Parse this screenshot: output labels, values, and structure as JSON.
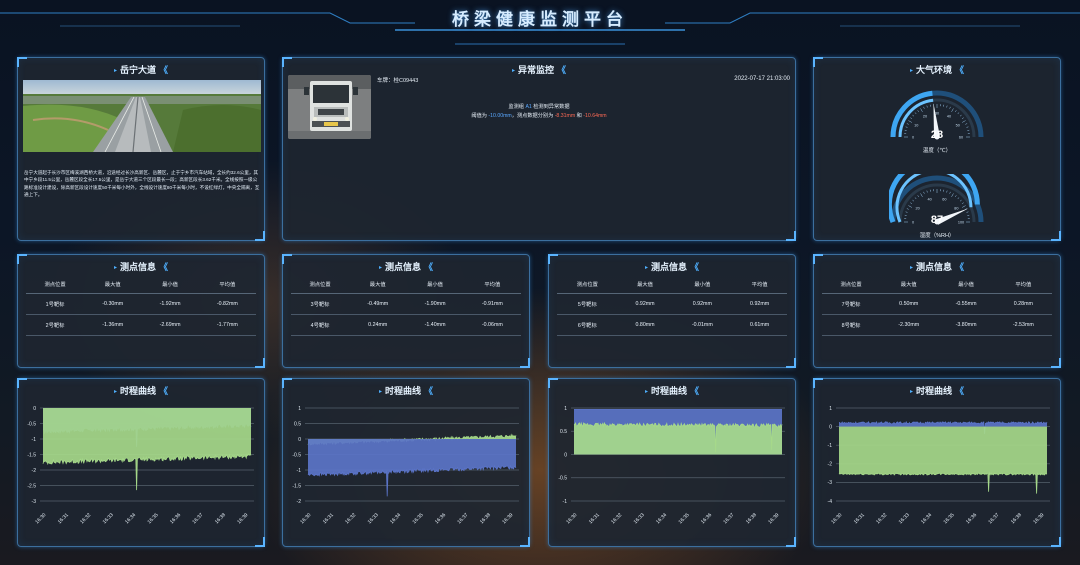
{
  "title": "桥梁健康监测平台",
  "road": {
    "title": "岳宁大道",
    "description": "岳宁大道起于长沙市区梅溪湖西桥大道，沿途经过长沙高新区、岳麓区，止于宁乡市汽车站域，全长约32.6公里，其中宁乡段11.5公里，岳麓区段全长17.5公里，是岳宁大道三个区段最长一段；高新区段长3.62千米。全线按照一级公路标准设计建设，除高新区段设计速度50千米每小时外，全线设计速度80千米每小时，不设红绿灯，中央全隔离，互通上下。"
  },
  "monitor": {
    "title": "异常监控",
    "plate": "车牌：桂C09443",
    "time": "2022-07-17 21:03:00",
    "line1_pre": "监测组 ",
    "line1_group": "A1",
    "line1_post": " 检测到异常数据",
    "line2_pre": "阈值为 ",
    "threshold": "-10.00mm",
    "line2_mid": "，测点数据分别为 ",
    "value1": "-8.31mm",
    "line2_and": " 和 ",
    "value2": "-10.64mm"
  },
  "env": {
    "title": "大气环境",
    "temp": {
      "value": 28,
      "max": 60,
      "label": "温度（℃）",
      "ticks": [
        "0",
        "10",
        "20",
        "30",
        "40",
        "50",
        "60"
      ]
    },
    "humidity": {
      "value": 87,
      "max": 100,
      "label": "湿度（%RH）",
      "ticks": [
        "0",
        "20",
        "40",
        "60",
        "80",
        "100"
      ]
    }
  },
  "tables": [
    {
      "title": "测点信息",
      "headers": [
        "测点位置",
        "最大值",
        "最小值",
        "平均值"
      ],
      "rows": [
        [
          "1号靶标",
          "-0.30mm",
          "-1.92mm",
          "-0.82mm"
        ],
        [
          "2号靶标",
          "-1.36mm",
          "-2.69mm",
          "-1.77mm"
        ]
      ]
    },
    {
      "title": "测点信息",
      "headers": [
        "测点位置",
        "最大值",
        "最小值",
        "平均值"
      ],
      "rows": [
        [
          "3号靶标",
          "-0.49mm",
          "-1.90mm",
          "-0.91mm"
        ],
        [
          "4号靶标",
          "0.24mm",
          "-1.40mm",
          "-0.06mm"
        ]
      ]
    },
    {
      "title": "测点信息",
      "headers": [
        "测点位置",
        "最大值",
        "最小值",
        "平均值"
      ],
      "rows": [
        [
          "5号靶标",
          "0.92mm",
          "0.92mm",
          "0.92mm"
        ],
        [
          "6号靶标",
          "0.80mm",
          "-0.01mm",
          "0.61mm"
        ]
      ]
    },
    {
      "title": "测点信息",
      "headers": [
        "测点位置",
        "最大值",
        "最小值",
        "平均值"
      ],
      "rows": [
        [
          "7号靶标",
          "0.50mm",
          "-0.55mm",
          "0.28mm"
        ],
        [
          "8号靶标",
          "-2.30mm",
          "-3.80mm",
          "-2.53mm"
        ]
      ]
    }
  ],
  "colors": {
    "blue_series": "#5b74c8",
    "green_series": "#a6d98a",
    "accent": "#4fb0ff",
    "alarm": "#ff6a55"
  },
  "chart_data": [
    {
      "type": "area",
      "title": "时程曲线",
      "x": [
        "16:30",
        "16:31",
        "16:32",
        "16:33",
        "16:34",
        "16:35",
        "16:36",
        "16:37",
        "16:38",
        "16:39"
      ],
      "ylim": [
        -3,
        0
      ],
      "yticks": [
        "0",
        "-0.5",
        "-1",
        "-1.5",
        "-2",
        "-2.5",
        "-3"
      ],
      "series": [
        {
          "color": "#5b74c8",
          "start": -0.75,
          "end": -0.55,
          "noise": 0.07,
          "spikes": [
            {
              "at": 0.45,
              "to": -1.25
            }
          ]
        },
        {
          "color": "#a6d98a",
          "start": -1.75,
          "end": -1.55,
          "noise": 0.07,
          "spikes": [
            {
              "at": 0.45,
              "to": -2.65
            }
          ]
        }
      ]
    },
    {
      "type": "area",
      "title": "时程曲线",
      "x": [
        "16:30",
        "16:31",
        "16:32",
        "16:33",
        "16:34",
        "16:35",
        "16:36",
        "16:37",
        "16:38",
        "16:39"
      ],
      "ylim": [
        -2,
        1
      ],
      "yticks": [
        "1",
        "0.5",
        "0",
        "-0.5",
        "-1",
        "-1.5",
        "-2"
      ],
      "series": [
        {
          "color": "#a6d98a",
          "start": -0.15,
          "end": 0.1,
          "noise": 0.05,
          "spikes": [
            {
              "at": 0.38,
              "to": -0.1
            }
          ]
        },
        {
          "color": "#5b74c8",
          "start": -1.15,
          "end": -0.9,
          "noise": 0.06,
          "spikes": [
            {
              "at": 0.38,
              "to": -1.85
            }
          ]
        }
      ]
    },
    {
      "type": "area",
      "title": "时程曲线",
      "x": [
        "16:30",
        "16:31",
        "16:32",
        "16:33",
        "16:34",
        "16:35",
        "16:36",
        "16:37",
        "16:38",
        "16:39"
      ],
      "ylim": [
        -1,
        1
      ],
      "yticks": [
        "1",
        "0.5",
        "0",
        "-0.5",
        "-1"
      ],
      "series": [
        {
          "color": "#5b74c8",
          "start": 0.97,
          "end": 0.97,
          "noise": 0.0,
          "spikes": []
        },
        {
          "color": "#a6d98a",
          "start": 0.64,
          "end": 0.62,
          "noise": 0.04,
          "spikes": [
            {
              "at": 0.68,
              "to": 0.05
            },
            {
              "at": 0.95,
              "to": 0.1
            }
          ]
        }
      ]
    },
    {
      "type": "area",
      "title": "时程曲线",
      "x": [
        "16:30",
        "16:31",
        "16:32",
        "16:33",
        "16:34",
        "16:35",
        "16:36",
        "16:37",
        "16:38",
        "16:39"
      ],
      "ylim": [
        -4,
        1
      ],
      "yticks": [
        "1",
        "0",
        "-1",
        "-2",
        "-3",
        "-4"
      ],
      "series": [
        {
          "color": "#5b74c8",
          "start": 0.2,
          "end": 0.2,
          "noise": 0.06,
          "spikes": [
            {
              "at": 0.7,
              "to": -0.4
            }
          ]
        },
        {
          "color": "#a6d98a",
          "start": -2.55,
          "end": -2.55,
          "noise": 0.05,
          "spikes": [
            {
              "at": 0.72,
              "to": -3.5
            },
            {
              "at": 0.95,
              "to": -3.6
            }
          ]
        }
      ]
    }
  ]
}
